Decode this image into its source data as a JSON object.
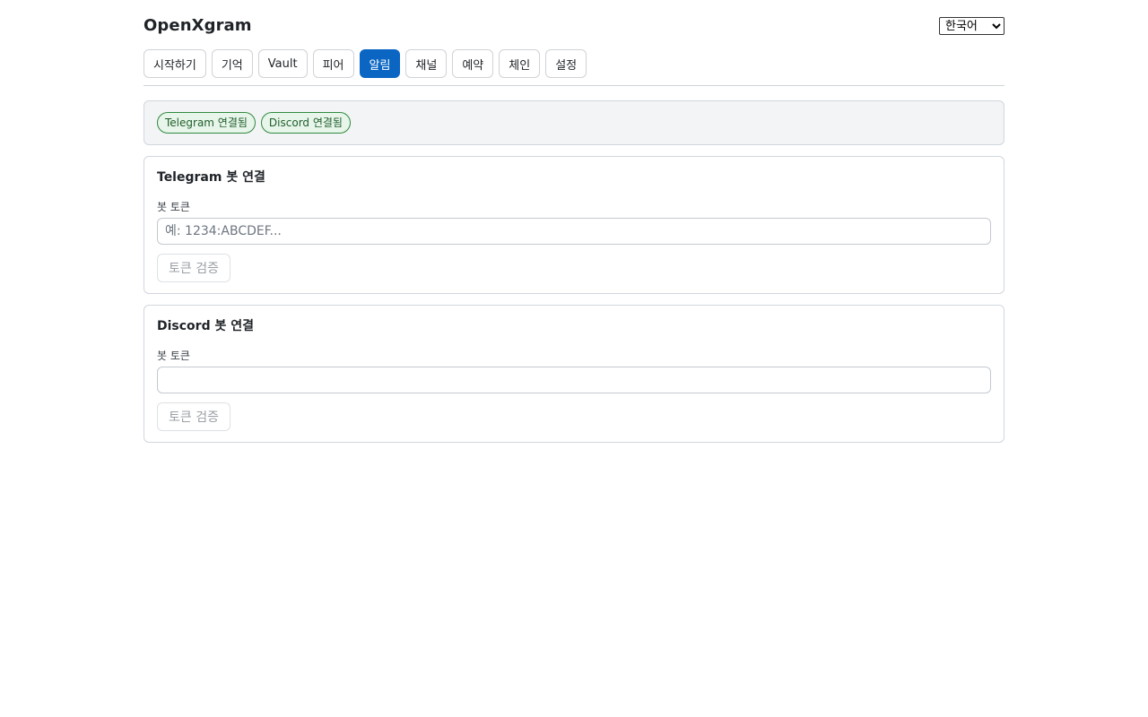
{
  "app": {
    "title": "OpenXgram",
    "language": {
      "selected": "한국어",
      "options": [
        "한국어"
      ]
    }
  },
  "nav": {
    "tabs": [
      {
        "label": "시작하기",
        "active": false
      },
      {
        "label": "기억",
        "active": false
      },
      {
        "label": "Vault",
        "active": false
      },
      {
        "label": "피어",
        "active": false
      },
      {
        "label": "알림",
        "active": true
      },
      {
        "label": "채널",
        "active": false
      },
      {
        "label": "예약",
        "active": false
      },
      {
        "label": "체인",
        "active": false
      },
      {
        "label": "설정",
        "active": false
      }
    ]
  },
  "status": {
    "badges": [
      "Telegram 연결됨",
      "Discord 연결됨"
    ]
  },
  "telegram": {
    "title": "Telegram 봇 연결",
    "token_label": "봇 토큰",
    "token_placeholder": "예: 1234:ABCDEF...",
    "token_value": "",
    "verify_label": "토큰 검증"
  },
  "discord": {
    "title": "Discord 봇 연결",
    "token_label": "봇 토큰",
    "token_placeholder": "",
    "token_value": "",
    "verify_label": "토큰 검증"
  },
  "colors": {
    "accent": "#0b66c3",
    "success_border": "#2f8a3f",
    "success_bg": "#e8f5ea"
  }
}
